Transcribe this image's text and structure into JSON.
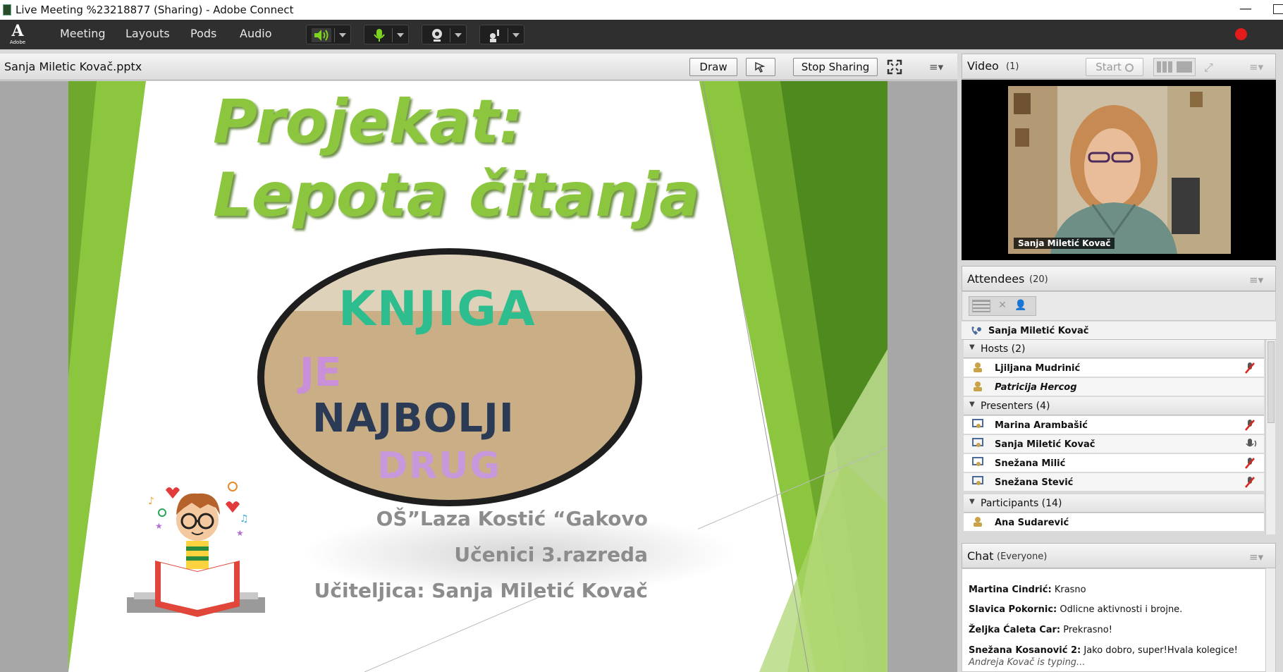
{
  "window": {
    "title": "Live Meeting %23218877 (Sharing) - Adobe Connect"
  },
  "logo": {
    "text": "Adobe"
  },
  "menu": {
    "items": [
      "Meeting",
      "Layouts",
      "Pods",
      "Audio"
    ]
  },
  "share": {
    "title": "Sanja Miletic Kovač.pptx",
    "draw_label": "Draw",
    "stop_sharing_label": "Stop Sharing"
  },
  "slide": {
    "line1": "Projekat:",
    "line2": "Lepota čitanja",
    "school": "OŠ”Laza Kostić “Gakovo",
    "students": "Učenici 3.razreda",
    "teacher": "Učiteljica: Sanja Miletić Kovač",
    "card_words": [
      "KNJIGA",
      "JE",
      "NAJBOLJI",
      "DRUG"
    ]
  },
  "video": {
    "title": "Video",
    "count": "(1)",
    "start_label": "Start",
    "caption": "Sanja Miletić Kovač"
  },
  "attendees": {
    "title": "Attendees",
    "count": "(20)",
    "me": "Sanja Miletić Kovač",
    "groups": [
      {
        "label": "Hosts (2)",
        "members": [
          "Ljiljana Mudrinić",
          "Patricija Hercog"
        ]
      },
      {
        "label": "Presenters (4)",
        "members": [
          "Marina Arambašić",
          "Sanja Miletić Kovač",
          "Snežana Milić",
          "Snežana Stević"
        ]
      },
      {
        "label": "Participants (14)",
        "members": [
          "Ana Sudarević"
        ]
      }
    ]
  },
  "chat": {
    "title": "Chat",
    "scope": "(Everyone)",
    "messages": [
      {
        "author": "Martina Cindrić:",
        "text": "Krasno"
      },
      {
        "author": "Slavica Pokornic:",
        "text": "Odlicne aktivnosti i brojne."
      },
      {
        "author": "Željka Ćaleta Car:",
        "text": "Prekrasno!"
      },
      {
        "author": "Snežana Kosanović 2:",
        "text": "Jako dobro, super!Hvala kolegice!"
      }
    ],
    "typing": "Andreja Kovač is typing..."
  },
  "colors": {
    "accent_green": "#8cc63f",
    "record_red": "#e31b1b",
    "menubar": "#2f2f2f"
  }
}
